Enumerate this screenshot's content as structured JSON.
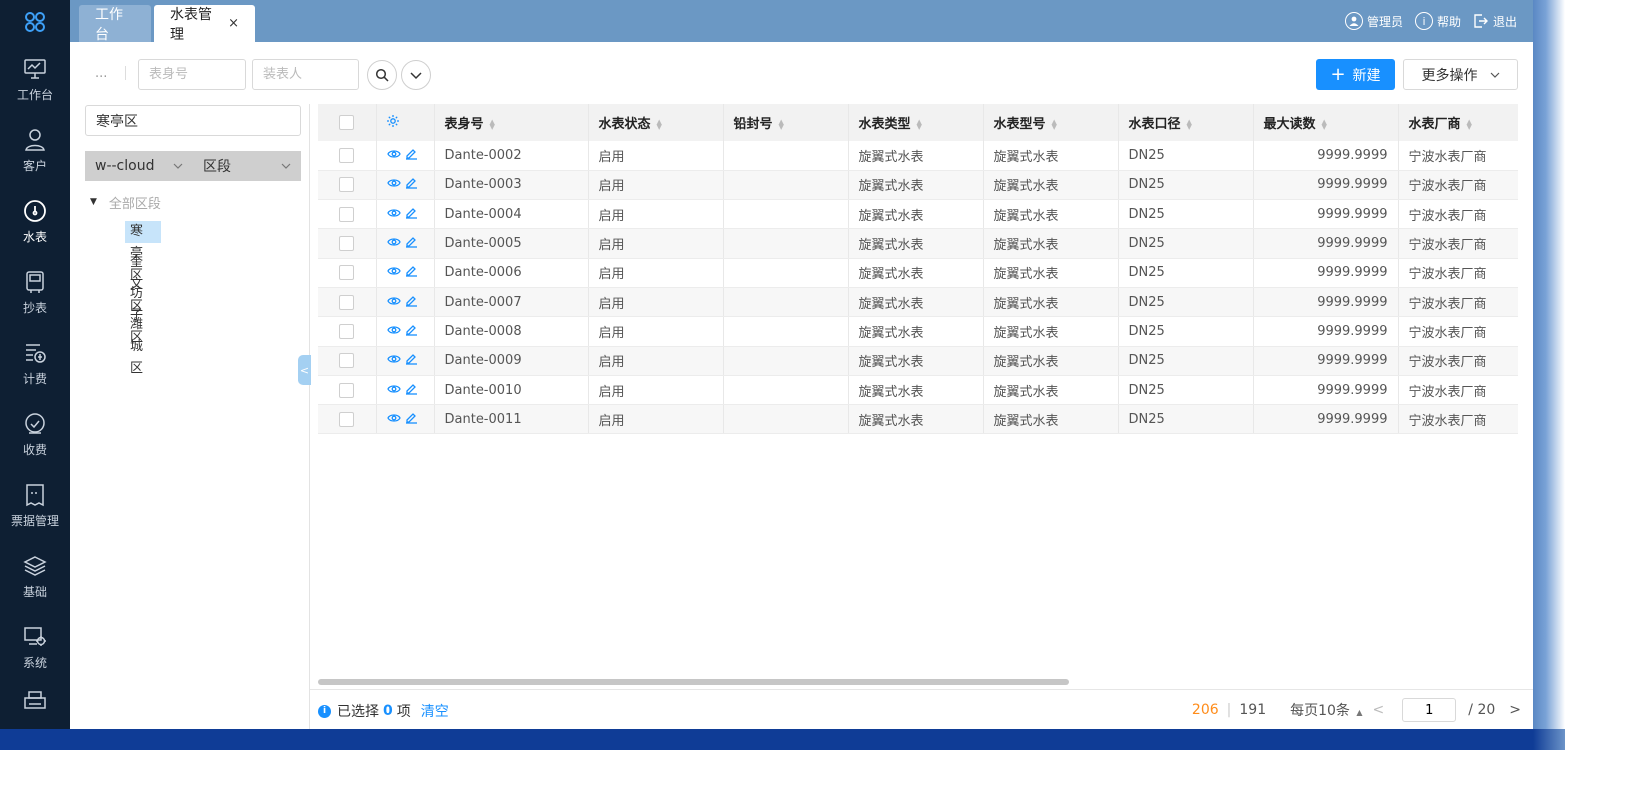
{
  "nav": {
    "items": [
      {
        "label": "工作台",
        "icon": "monitor-icon"
      },
      {
        "label": "客户",
        "icon": "user-icon"
      },
      {
        "label": "水表",
        "icon": "meter-gauge-icon"
      },
      {
        "label": "抄表",
        "icon": "meter-reading-icon"
      },
      {
        "label": "计费",
        "icon": "billing-icon"
      },
      {
        "label": "收费",
        "icon": "payment-icon"
      },
      {
        "label": "票据管理",
        "icon": "receipt-icon"
      },
      {
        "label": "基础",
        "icon": "layers-icon"
      },
      {
        "label": "系统",
        "icon": "system-settings-icon"
      }
    ],
    "active_index": 2
  },
  "header": {
    "tabs": [
      {
        "label": "工作台"
      },
      {
        "label": "水表管理",
        "close": "×"
      }
    ],
    "user": "管理员",
    "help": "帮助",
    "logout": "退出"
  },
  "toolbar": {
    "more": "...",
    "meter_no_placeholder": "表身号",
    "installer_placeholder": "装表人",
    "new_label": "新建",
    "more_ops_label": "更多操作"
  },
  "left": {
    "district_value": "寒亭区",
    "filter1": "w--cloud",
    "filter2": "区段",
    "tree_root": "全部区段",
    "tree_nodes": [
      "寒亭区",
      "奎文区",
      "坊子区",
      "潍城区"
    ],
    "selected_node": 0
  },
  "table": {
    "columns": [
      "表身号",
      "水表状态",
      "铅封号",
      "水表类型",
      "水表型号",
      "水表口径",
      "最大读数",
      "水表厂商"
    ],
    "rows": [
      {
        "no": "Dante-0002",
        "status": "启用",
        "seal": "",
        "type": "旋翼式水表",
        "model": "旋翼式水表",
        "caliber": "DN25",
        "max": "9999.9999",
        "maker": "宁波水表厂商"
      },
      {
        "no": "Dante-0003",
        "status": "启用",
        "seal": "",
        "type": "旋翼式水表",
        "model": "旋翼式水表",
        "caliber": "DN25",
        "max": "9999.9999",
        "maker": "宁波水表厂商"
      },
      {
        "no": "Dante-0004",
        "status": "启用",
        "seal": "",
        "type": "旋翼式水表",
        "model": "旋翼式水表",
        "caliber": "DN25",
        "max": "9999.9999",
        "maker": "宁波水表厂商"
      },
      {
        "no": "Dante-0005",
        "status": "启用",
        "seal": "",
        "type": "旋翼式水表",
        "model": "旋翼式水表",
        "caliber": "DN25",
        "max": "9999.9999",
        "maker": "宁波水表厂商"
      },
      {
        "no": "Dante-0006",
        "status": "启用",
        "seal": "",
        "type": "旋翼式水表",
        "model": "旋翼式水表",
        "caliber": "DN25",
        "max": "9999.9999",
        "maker": "宁波水表厂商"
      },
      {
        "no": "Dante-0007",
        "status": "启用",
        "seal": "",
        "type": "旋翼式水表",
        "model": "旋翼式水表",
        "caliber": "DN25",
        "max": "9999.9999",
        "maker": "宁波水表厂商"
      },
      {
        "no": "Dante-0008",
        "status": "启用",
        "seal": "",
        "type": "旋翼式水表",
        "model": "旋翼式水表",
        "caliber": "DN25",
        "max": "9999.9999",
        "maker": "宁波水表厂商"
      },
      {
        "no": "Dante-0009",
        "status": "启用",
        "seal": "",
        "type": "旋翼式水表",
        "model": "旋翼式水表",
        "caliber": "DN25",
        "max": "9999.9999",
        "maker": "宁波水表厂商"
      },
      {
        "no": "Dante-0010",
        "status": "启用",
        "seal": "",
        "type": "旋翼式水表",
        "model": "旋翼式水表",
        "caliber": "DN25",
        "max": "9999.9999",
        "maker": "宁波水表厂商"
      },
      {
        "no": "Dante-0011",
        "status": "启用",
        "seal": "",
        "type": "旋翼式水表",
        "model": "旋翼式水表",
        "caliber": "DN25",
        "max": "9999.9999",
        "maker": "宁波水表厂商"
      }
    ]
  },
  "footer": {
    "selected_prefix": "已选择",
    "selected_count": "0",
    "selected_suffix": "项",
    "clear": "清空",
    "total_a": "206",
    "total_b": "191",
    "page_size": "每页10条",
    "current_page": "1",
    "total_pages": "/ 20"
  },
  "colors": {
    "accent": "#1890ff",
    "nav_bg": "#0e1f33",
    "header_bg": "#6b98c4",
    "total_highlight": "#ff8c1a"
  }
}
